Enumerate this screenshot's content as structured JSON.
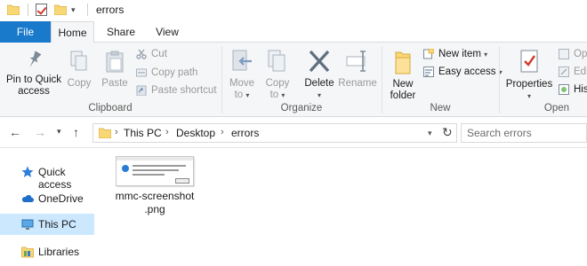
{
  "window": {
    "title": "errors"
  },
  "quick_access_toolbar": {
    "icons": [
      "folder-icon",
      "properties-check-icon",
      "new-folder-icon"
    ]
  },
  "tabs": [
    {
      "label": "File",
      "active": false
    },
    {
      "label": "Home",
      "active": true
    },
    {
      "label": "Share",
      "active": false
    },
    {
      "label": "View",
      "active": false
    }
  ],
  "ribbon": {
    "clipboard": {
      "label": "Clipboard",
      "pin": "Pin to Quick\naccess",
      "pin_line1": "Pin to Quick",
      "pin_line2": "access",
      "copy": "Copy",
      "paste": "Paste",
      "cut": "Cut",
      "copy_path": "Copy path",
      "paste_shortcut": "Paste shortcut"
    },
    "organize": {
      "label": "Organize",
      "move_to_line1": "Move",
      "move_to_line2": "to",
      "copy_to_line1": "Copy",
      "copy_to_line2": "to",
      "delete": "Delete",
      "rename": "Rename"
    },
    "new": {
      "label": "New",
      "new_folder_line1": "New",
      "new_folder_line2": "folder",
      "new_item": "New item",
      "easy_access": "Easy access"
    },
    "open": {
      "label": "Open",
      "properties": "Properties",
      "open": "Op",
      "edit": "Edi",
      "history": "Hist"
    }
  },
  "address_bar": {
    "breadcrumbs": [
      "This PC",
      "Desktop",
      "errors"
    ],
    "search_placeholder": "Search errors"
  },
  "navigation_pane": {
    "items": [
      {
        "label": "Quick access",
        "icon": "star-icon",
        "selected": false
      },
      {
        "label": "OneDrive",
        "icon": "cloud-icon",
        "selected": false
      },
      {
        "label": "This PC",
        "icon": "computer-icon",
        "selected": true
      },
      {
        "label": "Libraries",
        "icon": "libraries-icon",
        "selected": false
      }
    ]
  },
  "files": [
    {
      "name_line1": "mmc-screenshot",
      "name_line2": ".png"
    }
  ],
  "colors": {
    "file_tab": "#1979ca",
    "selected_nav": "#cce8ff",
    "ribbon_bg": "#f5f6f7",
    "folder_yellow": "#f8d775"
  }
}
